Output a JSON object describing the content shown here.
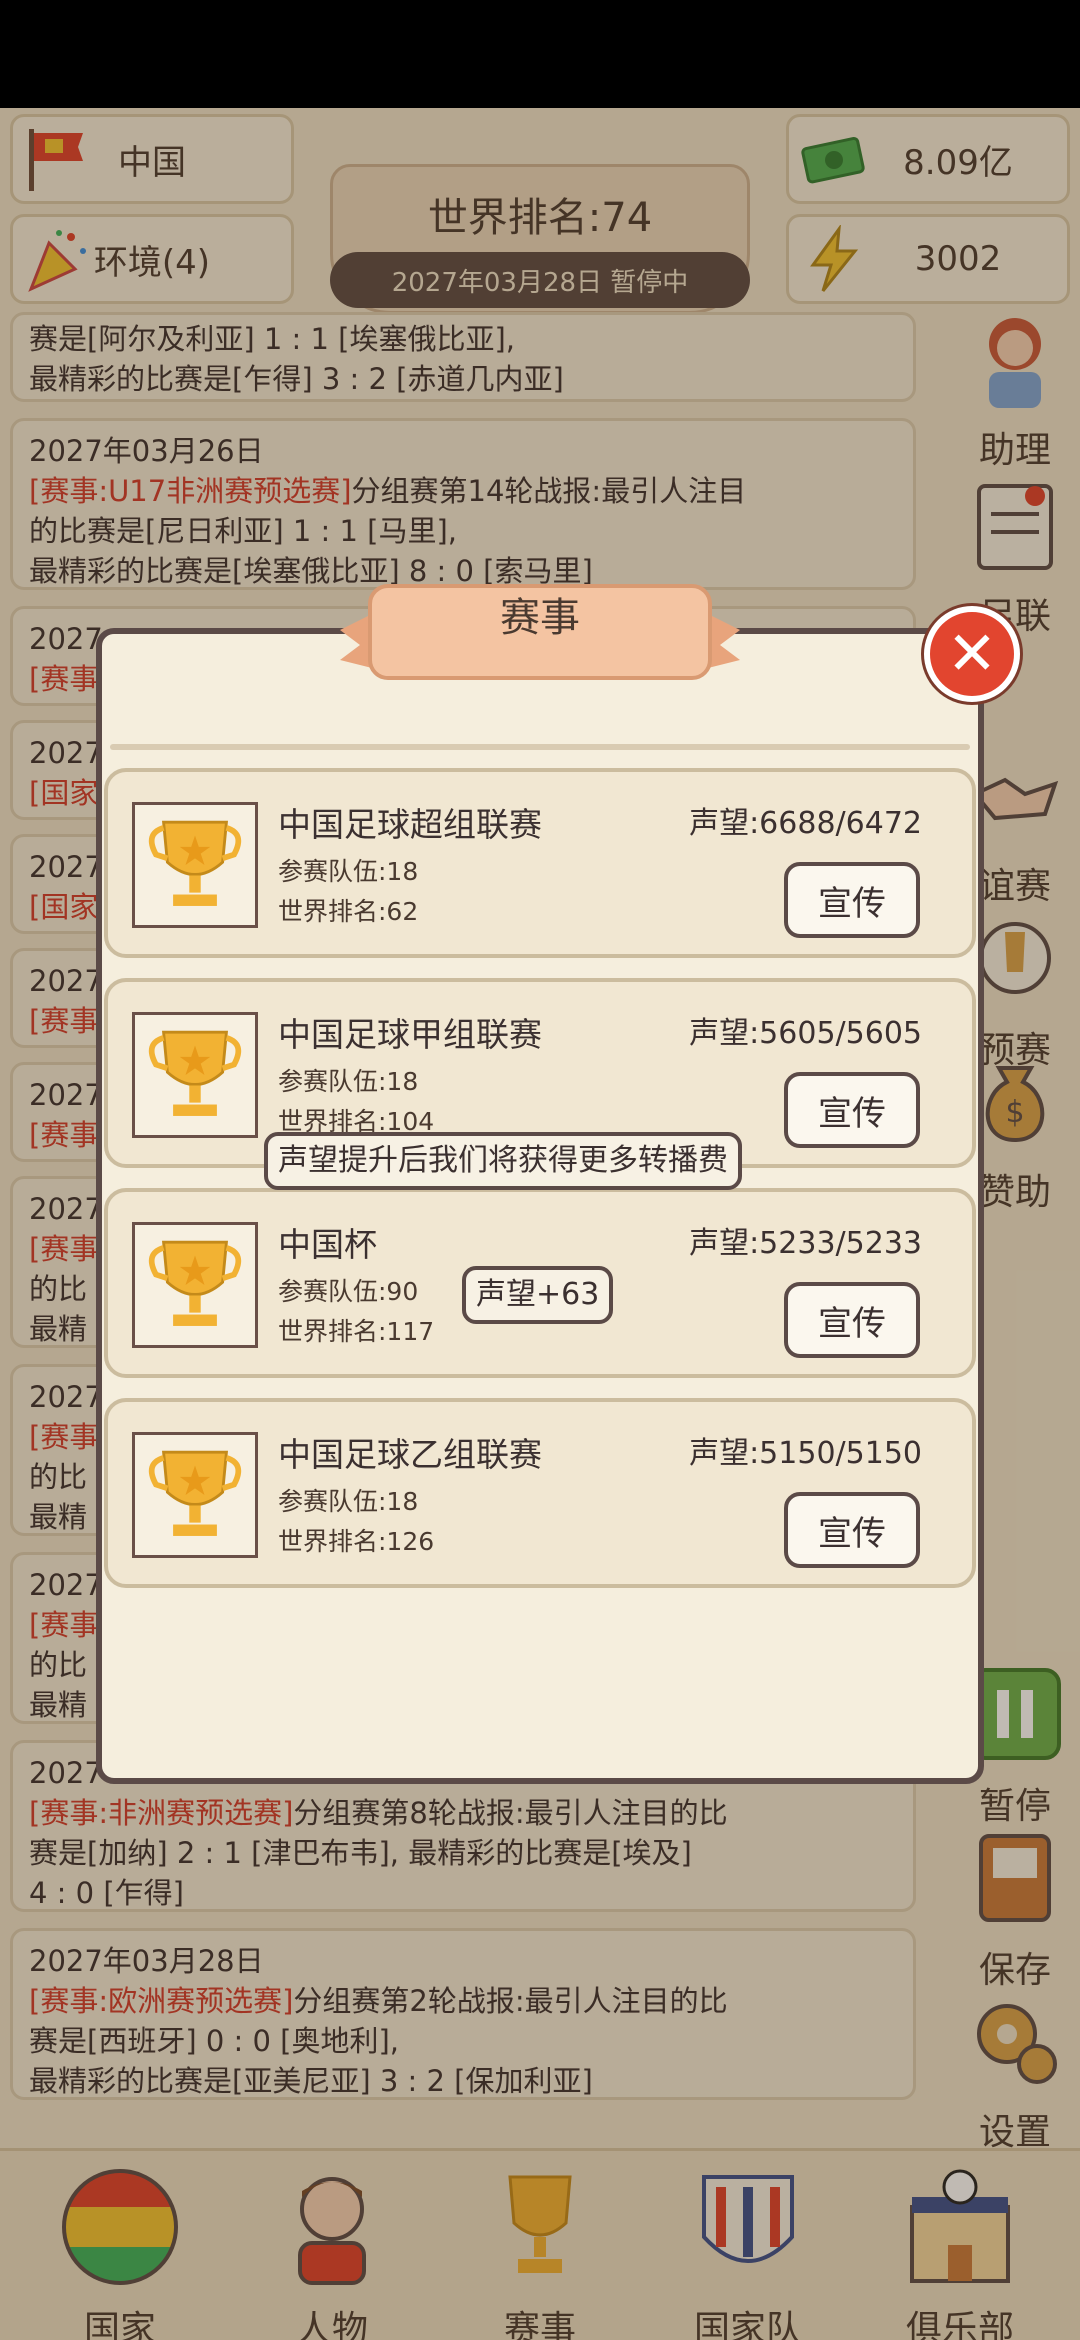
{
  "topbar": {
    "country": "中国",
    "environment": "环境(4)",
    "money": "8.09亿",
    "energy": "3002",
    "rank_label": "世界排名:74",
    "date_status": "2027年03月28日  暂停中"
  },
  "news": [
    {
      "line1": "赛是[阿尔及利亚] 1 : 1 [埃塞俄比亚],",
      "line2": "最精彩的比赛是[乍得] 3 : 2 [赤道几内亚]"
    },
    {
      "date": "2027年03月26日",
      "tag": "[赛事:U17非洲赛预选赛]",
      "text1": "分组赛第14轮战报:最引人注目",
      "text2": "的比赛是[尼日利亚] 1 : 1 [马里],",
      "text3": "最精彩的比赛是[埃塞俄比亚] 8 : 0 [索马里]"
    },
    {
      "date": "2027",
      "tag": "[赛事"
    },
    {
      "date": "2027",
      "tag": "[国家"
    },
    {
      "date": "2027",
      "tag": "[国家"
    },
    {
      "date": "2027",
      "tag": "[赛事"
    },
    {
      "date": "2027",
      "tag": "[赛事"
    },
    {
      "date": "2027",
      "tag": "[赛事",
      "t2": "的比",
      "t3": "最精"
    },
    {
      "date": "2027",
      "tag": "[赛事",
      "t2": "的比",
      "t3": "最精"
    },
    {
      "date": "2027",
      "tag": "[赛事",
      "t2": "的比",
      "t3": "最精"
    },
    {
      "date": "2027",
      "tag": "[赛事:非洲赛预选赛]",
      "text1": "分组赛第8轮战报:最引人注目的比",
      "text2": "赛是[加纳] 2 : 1 [津巴布韦], 最精彩的比赛是[埃及]",
      "text3": "4 : 0 [乍得]"
    },
    {
      "date": "2027年03月28日",
      "tag": "[赛事:欧洲赛预选赛]",
      "text1": "分组赛第2轮战报:最引人注目的比",
      "text2": "赛是[西班牙] 0 : 0 [奥地利],",
      "text3": "最精彩的比赛是[亚美尼亚] 3 : 2 [保加利亚]"
    }
  ],
  "side": {
    "assistant": "助理",
    "league": "足联",
    "friendly": "谊赛",
    "qualifier": "预赛",
    "sponsor": "赞助",
    "pause": "暂停",
    "save": "保存",
    "settings": "设置"
  },
  "modal": {
    "title": "赛事",
    "close_icon": "close-icon",
    "promote_label": "宣传",
    "teams_prefix": "参赛队伍:",
    "rank_prefix": "世界排名:",
    "competitions": [
      {
        "name": "中国足球超组联赛",
        "teams": "参赛队伍:18",
        "rank": "世界排名:62",
        "fame": "声望:6688/6472"
      },
      {
        "name": "中国足球甲组联赛",
        "teams": "参赛队伍:18",
        "rank": "世界排名:104",
        "fame": "声望:5605/5605"
      },
      {
        "name": "中国杯",
        "teams": "参赛队伍:90",
        "rank": "世界排名:117",
        "fame": "声望:5233/5233"
      },
      {
        "name": "中国足球乙组联赛",
        "teams": "参赛队伍:18",
        "rank": "世界排名:126",
        "fame": "声望:5150/5150"
      }
    ],
    "tooltip": "声望提升后我们将获得更多转播费",
    "fame_bonus": "声望+63"
  },
  "nav": {
    "country": "国家",
    "people": "人物",
    "events": "赛事",
    "national_team": "国家队",
    "club": "俱乐部"
  },
  "colors": {
    "background": "#efe4cc",
    "accent_red": "#d33a2c",
    "trophy_gold": "#f2b233",
    "border_dark": "#5b4a47"
  }
}
